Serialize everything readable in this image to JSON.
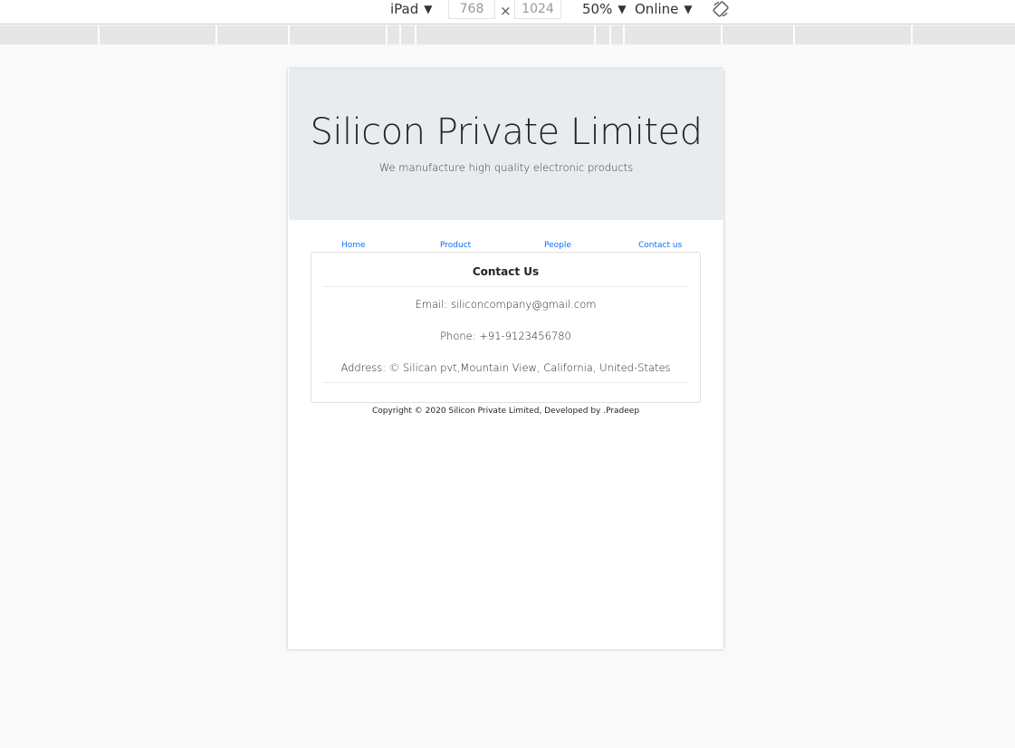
{
  "toolbar": {
    "device_select": "iPad",
    "width_value": "768",
    "dim_separator": "×",
    "height_value": "1024",
    "zoom_select": "50%",
    "throttle_select": "Online",
    "caret": "▼",
    "rotate_icon": "rotate-icon"
  },
  "site": {
    "title": "Silicon Private Limited",
    "tagline": "We manufacture high quality electronic products",
    "nav": [
      "Home",
      "Product",
      "People",
      "Contact us"
    ],
    "accent_color": "#0d6efd",
    "jumbotron_color": "#e9ecef"
  },
  "contact": {
    "title": "Contact Us",
    "email": "Email: siliconcompany@gmail.com",
    "phone": "Phone: +91-9123456780",
    "address": "Address: © Silican pvt,Mountain View, California, United-States"
  },
  "footer": {
    "copyright": "Copyright © 2020 Silicon Private Limited, Developed by .Pradeep"
  }
}
